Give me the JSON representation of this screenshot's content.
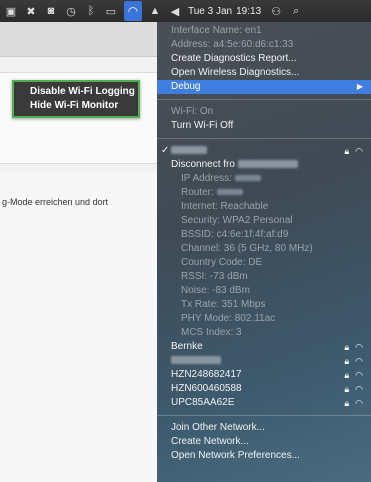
{
  "menubar": {
    "date": "Tue 3 Jan",
    "time": "19:13",
    "icons": [
      "screen-icon",
      "app-icon",
      "display-icon",
      "time-machine-icon",
      "bluetooth-icon",
      "battery-icon",
      "wifi-icon",
      "airplay-icon",
      "volume-icon",
      "user-icon",
      "search-icon"
    ]
  },
  "background": {
    "text": "g-Mode erreichen und dort"
  },
  "submenu": {
    "items": [
      "Disable Wi-Fi Logging",
      "Hide Wi-Fi Monitor"
    ]
  },
  "menu": {
    "interface_name": "Interface Name: en1",
    "address": "Address: a4:5e:60:d6:c1:33",
    "create_diagnostics": "Create Diagnostics Report...",
    "open_wireless_diagnostics": "Open Wireless Diagnostics...",
    "debug": "Debug",
    "wifi_on": "Wi-Fi: On",
    "turn_wifi_off": "Turn Wi-Fi Off",
    "disconnect": "Disconnect fro",
    "details": [
      "IP Address:",
      "Router:",
      "Internet: Reachable",
      "Security: WPA2 Personal",
      "BSSID: c4:6e:1f:4f:af:d9",
      "Channel: 36 (5 GHz, 80 MHz)",
      "Country Code: DE",
      "RSSI: -73 dBm",
      "Noise: -83 dBm",
      "Tx Rate: 351 Mbps",
      "PHY Mode: 802.11ac",
      "MCS Index: 3"
    ],
    "networks": [
      "Bernke",
      "",
      "HZN248682417",
      "HZN600460588",
      "UPC85AA62E"
    ],
    "join_other": "Join Other Network...",
    "create_network": "Create Network...",
    "open_preferences": "Open Network Preferences..."
  }
}
